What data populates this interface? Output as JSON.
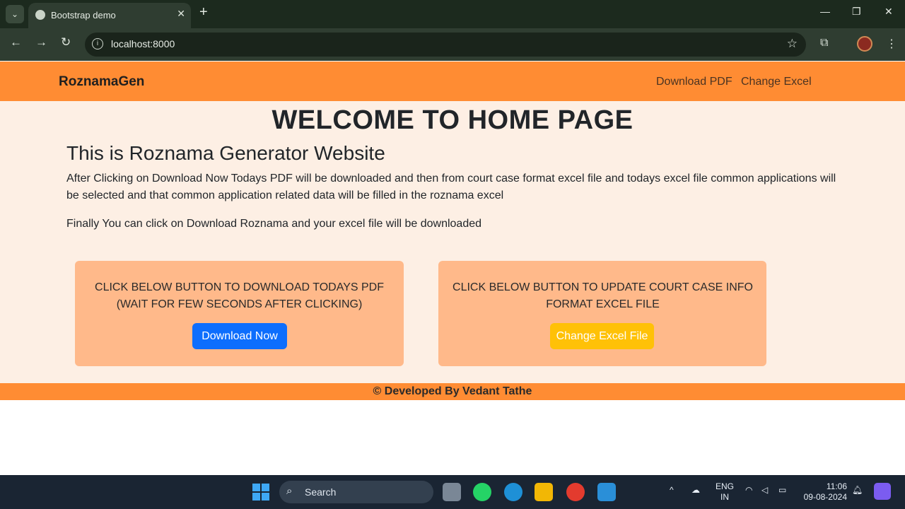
{
  "browser": {
    "tab_title": "Bootstrap demo",
    "url": "localhost:8000"
  },
  "navbar": {
    "brand": "RoznamaGen",
    "links": [
      "Download PDF",
      "Change Excel"
    ]
  },
  "main": {
    "heading": "WELCOME TO HOME PAGE",
    "subtitle": "This is Roznama Generator Website",
    "paragraph1": "After Clicking on Download Now Todays PDF will be downloaded and then from court case format excel file and todays excel file common applications will be selected and that common application related data will be filled in the roznama excel",
    "paragraph2": "Finally You can click on Download Roznama and your excel file will be downloaded",
    "cards": [
      {
        "line1": "CLICK BELOW BUTTON TO DOWNLOAD TODAYS PDF",
        "line2": "(WAIT FOR FEW SECONDS AFTER CLICKING)",
        "button": "Download Now",
        "button_color": "#0d6efd"
      },
      {
        "line1": "CLICK BELOW BUTTON TO UPDATE COURT CASE INFO",
        "line2": "FORMAT EXCEL FILE",
        "button": "Change Excel File",
        "button_color": "#ffc107"
      }
    ]
  },
  "footer": {
    "text": "© Developed By Vedant Tathe"
  },
  "taskbar": {
    "search_label": "Search",
    "language_line1": "ENG",
    "language_line2": "IN",
    "time": "11:06",
    "date": "09-08-2024"
  },
  "colors": {
    "navbar_bg": "#ff8c33",
    "content_bg": "#fdefe4",
    "card_bg": "#ffb98a"
  }
}
